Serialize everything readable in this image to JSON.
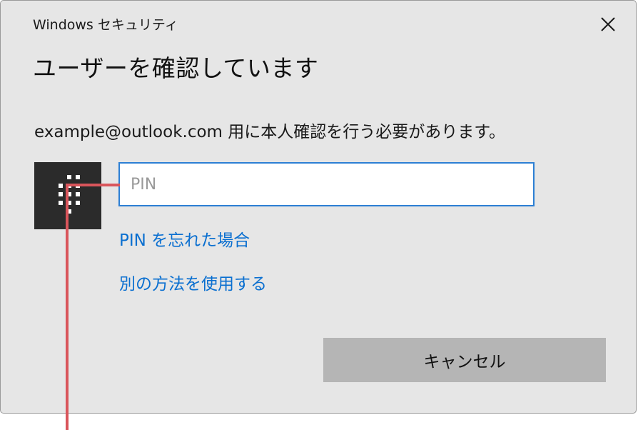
{
  "window": {
    "title": "Windows セキュリティ",
    "close_icon": "close-icon"
  },
  "heading": "ユーザーを確認しています",
  "message": "example@outlook.com 用に本人確認を行う必要があります。",
  "pin": {
    "icon": "keypad-icon",
    "placeholder": "PIN",
    "value": ""
  },
  "links": {
    "forgot_pin": "PIN を忘れた場合",
    "other_method": "別の方法を使用する"
  },
  "buttons": {
    "cancel": "キャンセル"
  },
  "colors": {
    "dialog_bg": "#e6e6e6",
    "accent": "#2c7fd4",
    "link": "#0a6fd0",
    "button": "#b5b5b5",
    "callout": "#d9555b"
  }
}
